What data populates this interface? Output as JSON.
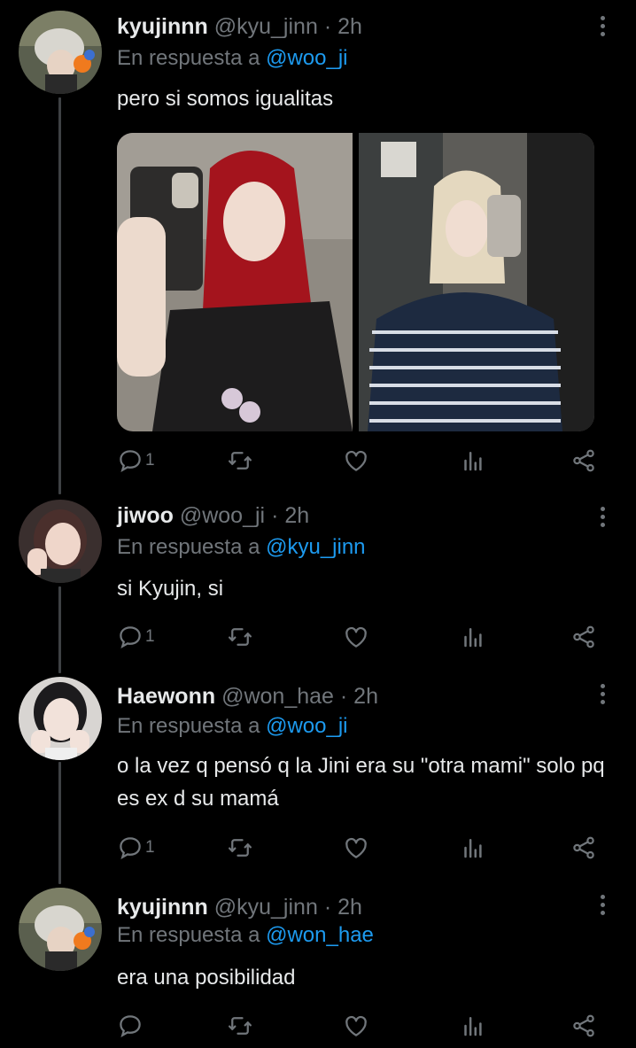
{
  "tweets": [
    {
      "name": "kyujinnn",
      "handle": "@kyu_jinn",
      "time": "2h",
      "reply_prefix": "En respuesta a",
      "reply_to": "@woo_ji",
      "text": "pero si somos igualitas",
      "reply_count": "1",
      "media": [
        "photo-red-hair-mirror-selfie",
        "photo-blonde-striped-sweater-mirror-selfie"
      ]
    },
    {
      "name": "jiwoo",
      "handle": "@woo_ji",
      "time": "2h",
      "reply_prefix": "En respuesta a",
      "reply_to": "@kyu_jinn",
      "text": "si Kyujin, si",
      "reply_count": "1"
    },
    {
      "name": "Haewonn",
      "handle": "@won_hae",
      "time": "2h",
      "reply_prefix": "En respuesta a",
      "reply_to": "@woo_ji",
      "text": "o la vez q pensó q la Jini era su \"otra mami\" solo pq es ex d su mamá",
      "reply_count": "1"
    },
    {
      "name": "kyujinnn",
      "handle": "@kyu_jinn",
      "time": "2h",
      "reply_prefix": "En respuesta a",
      "reply_to": "@won_hae",
      "text": "era una posibilidad",
      "reply_count": ""
    }
  ],
  "separator": "·",
  "icons": [
    "reply-icon",
    "retweet-icon",
    "like-icon",
    "views-icon",
    "share-icon",
    "more-icon"
  ],
  "colors": {
    "background": "#000000",
    "text": "#e7e9ea",
    "muted": "#71767b",
    "link": "#1d9bf0",
    "thread": "#3e4144"
  }
}
